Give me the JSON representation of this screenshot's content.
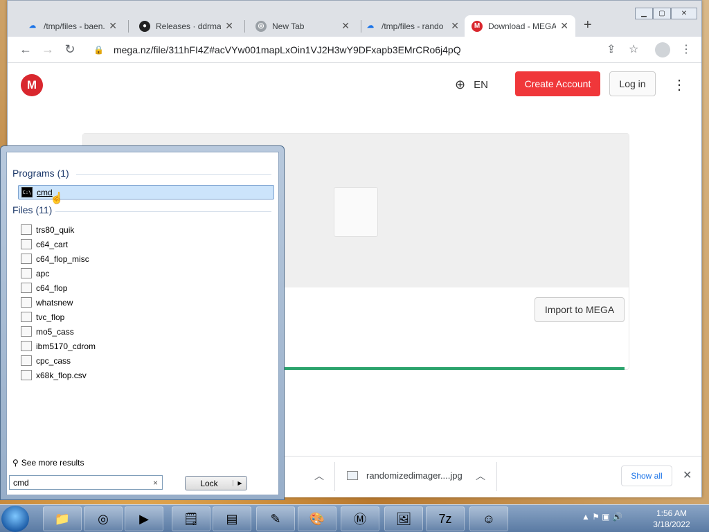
{
  "browser": {
    "tabs": [
      {
        "title": "/tmp/files - baen.p",
        "favicon": "cloud-icon"
      },
      {
        "title": "Releases · ddrmax",
        "favicon": "github-icon"
      },
      {
        "title": "New Tab",
        "favicon": "chrome-icon"
      },
      {
        "title": "/tmp/files - rando",
        "favicon": "cloud-icon"
      },
      {
        "title": "Download - MEGA",
        "favicon": "mega-icon",
        "active": true
      }
    ],
    "url": "mega.nz/file/311hFI4Z#acVYw001mapLxOin1VJ2H3wY9DFxapb3EMrCRo6j4pQ"
  },
  "mega": {
    "logo": "M",
    "language": "EN",
    "create_account": "Create Account",
    "login": "Log in",
    "import": "Import to MEGA",
    "progress": 1.0,
    "accent_color": "#f0373a"
  },
  "downloads": {
    "file": "randomizedimager....jpg",
    "show_all": "Show all"
  },
  "startmenu": {
    "programs_header": "Programs (1)",
    "programs": [
      "cmd"
    ],
    "files_header": "Files (11)",
    "files": [
      "trs80_quik",
      "c64_cart",
      "c64_flop_misc",
      "apc",
      "c64_flop",
      "whatsnew",
      "tvc_flop",
      "mo5_cass",
      "ibm5170_cdrom",
      "cpc_cass",
      "x68k_flop.csv"
    ],
    "see_more": "See more results",
    "search_value": "cmd",
    "lock_label": "Lock"
  },
  "taskbar": {
    "time": "1:56 AM",
    "date": "3/18/2022"
  }
}
